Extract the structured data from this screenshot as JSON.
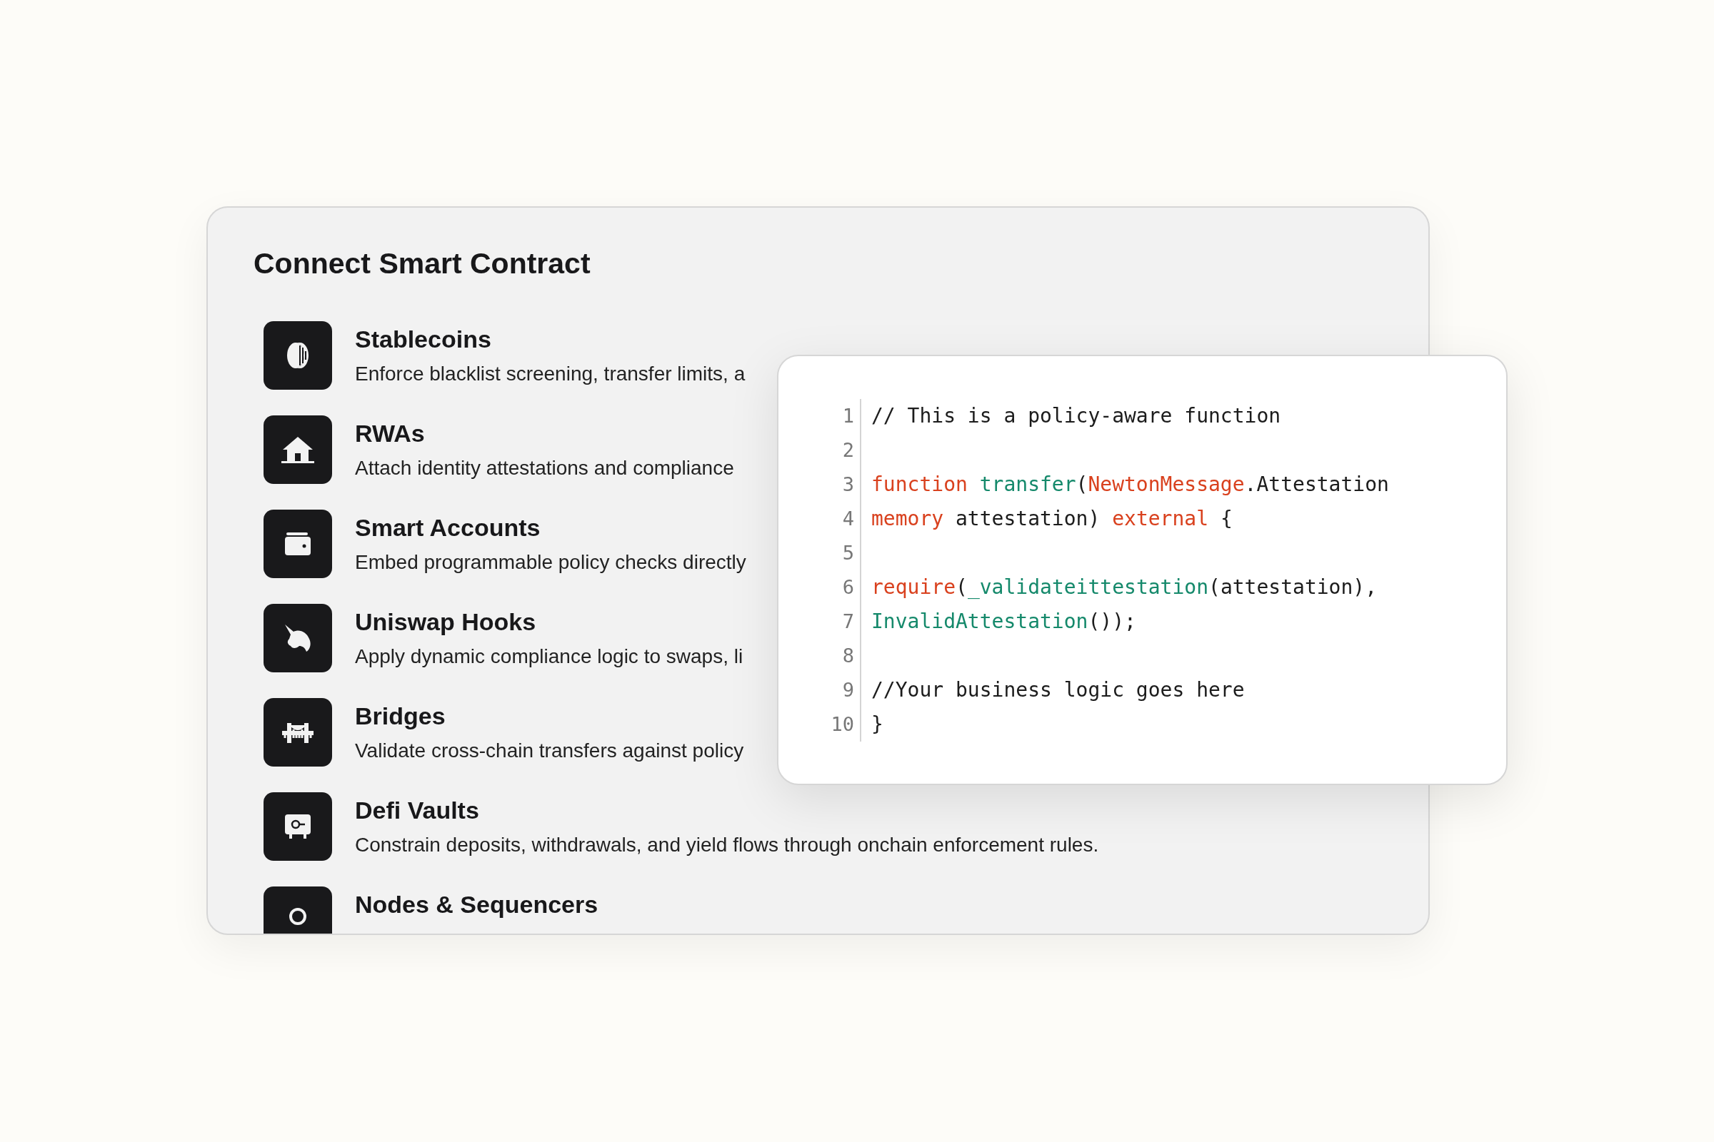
{
  "panel": {
    "title": "Connect Smart Contract",
    "items": [
      {
        "title": "Stablecoins",
        "description": "Enforce blacklist screening, transfer limits, a"
      },
      {
        "title": "RWAs",
        "description": "Attach identity attestations and compliance"
      },
      {
        "title": "Smart Accounts",
        "description": "Embed programmable policy checks directly"
      },
      {
        "title": "Uniswap Hooks",
        "description": "Apply dynamic compliance logic to swaps, li"
      },
      {
        "title": "Bridges",
        "description": "Validate cross-chain transfers against policy"
      },
      {
        "title": "Defi Vaults",
        "description": "Constrain deposits, withdrawals, and yield flows through onchain enforcement rules."
      },
      {
        "title": "Nodes & Sequencers"
      }
    ]
  },
  "code": {
    "lines": [
      {
        "number": "1",
        "tokens": [
          {
            "kind": "plain",
            "text": "// This is a policy-aware function"
          }
        ]
      },
      {
        "number": "2"
      },
      {
        "number": "3",
        "tokens": [
          {
            "kind": "keyword",
            "text": "function"
          },
          {
            "kind": "name",
            "text": "transfer",
            "spaced": true
          },
          {
            "kind": "plain",
            "text": "("
          },
          {
            "kind": "keyword",
            "text": "NewtonMessage"
          },
          {
            "kind": "plain",
            "text": ".Attestation"
          }
        ]
      },
      {
        "number": "4",
        "tokens": [
          {
            "kind": "keyword",
            "text": "memory"
          },
          {
            "kind": "plain",
            "text": " attestation) "
          },
          {
            "kind": "keyword",
            "text": "external"
          },
          {
            "kind": "plain",
            "text": " {"
          }
        ]
      },
      {
        "number": "5"
      },
      {
        "number": "6",
        "tokens": [
          {
            "kind": "keyword",
            "text": "require"
          },
          {
            "kind": "plain",
            "text": "("
          },
          {
            "kind": "name",
            "text": "_validateittestation"
          },
          {
            "kind": "plain",
            "text": "(attestation),"
          }
        ]
      },
      {
        "number": "7",
        "tokens": [
          {
            "kind": "name",
            "text": "InvalidAttestation"
          },
          {
            "kind": "plain",
            "text": "());"
          }
        ]
      },
      {
        "number": "8"
      },
      {
        "number": "9",
        "tokens": [
          {
            "kind": "plain",
            "text": "//Your business logic goes here"
          }
        ]
      },
      {
        "number": "10",
        "tokens": [
          {
            "kind": "plain",
            "text": "}"
          }
        ]
      }
    ]
  }
}
